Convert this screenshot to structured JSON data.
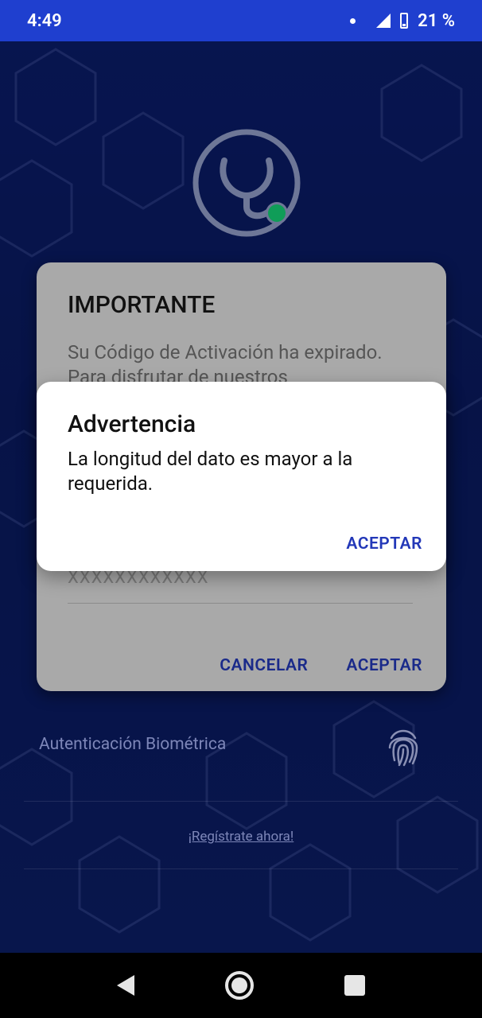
{
  "status_bar": {
    "time": "4:49",
    "battery": "21 %"
  },
  "login": {
    "biometric_label": "Autenticación Biométrica",
    "register_link": "¡Regístrate ahora!"
  },
  "dialog_important": {
    "title": "IMPORTANTE",
    "text": "Su Código de Activación ha expirado. Para disfrutar de nuestros",
    "input_value": "XXXXXXXXXXXX",
    "cancel_label": "CANCELAR",
    "accept_label": "ACEPTAR"
  },
  "dialog_warning": {
    "title": "Advertencia",
    "message": "La longitud del dato es mayor a la requerida.",
    "accept_label": "ACEPTAR"
  },
  "colors": {
    "status_bar": "#1f3fcf",
    "accent": "#2338b8",
    "logo_dot": "#0f9d58"
  },
  "icons": [
    "stethoscope-logo-icon",
    "fingerprint-icon",
    "nav-back-icon",
    "nav-home-icon",
    "nav-recent-icon",
    "signal-icon",
    "battery-icon"
  ]
}
